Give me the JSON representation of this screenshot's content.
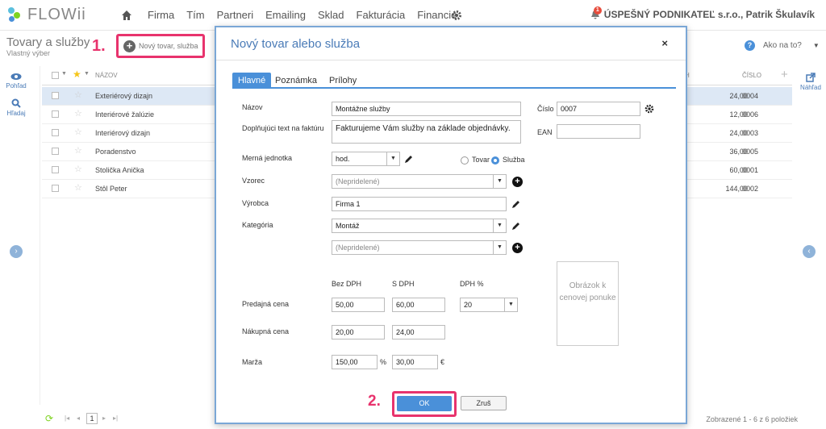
{
  "app": {
    "logo_text": "FLOWii"
  },
  "nav": {
    "items": [
      "Firma",
      "Tím",
      "Partneri",
      "Emailing",
      "Sklad",
      "Fakturácia",
      "Financie"
    ],
    "notifications_count": "1",
    "company": "ÚSPEŠNÝ PODNIKATEĽ s.r.o., Patrik Škulavík"
  },
  "page": {
    "title": "Tovary a služby",
    "subtitle": "Vlastný výber",
    "step1": "1.",
    "new_button": "Nový tovar, služba",
    "help": "Ako na to?"
  },
  "sidebar": {
    "view": "Pohľad",
    "search": "Hľadaj",
    "preview": "Náhľad"
  },
  "grid": {
    "col_name": "NÁZOV",
    "col_price_partial": "H",
    "col_number": "ČÍSLO",
    "rows": [
      {
        "name": "Exteriérový dizajn",
        "price": "24,00",
        "number": "0004"
      },
      {
        "name": "Interiérové žalúzie",
        "price": "12,00",
        "number": "0006"
      },
      {
        "name": "Interiérový dizajn",
        "price": "24,00",
        "number": "0003"
      },
      {
        "name": "Poradenstvo",
        "price": "36,00",
        "number": "0005"
      },
      {
        "name": "Stolička Anička",
        "price": "60,00",
        "number": "0001"
      },
      {
        "name": "Stôl Peter",
        "price": "144,00",
        "number": "0002"
      }
    ]
  },
  "footer": {
    "page": "1",
    "summary": "Zobrazené 1 - 6 z 6 položiek"
  },
  "modal": {
    "title": "Nový tovar alebo služba",
    "close": "×",
    "tabs": [
      "Hlavné",
      "Poznámka",
      "Prílohy"
    ],
    "labels": {
      "name": "Názov",
      "invoice_text": "Doplňujúci text na faktúru",
      "unit": "Merná jednotka",
      "pattern": "Vzorec",
      "manufacturer": "Výrobca",
      "category": "Kategória",
      "number": "Číslo",
      "ean": "EAN",
      "goods": "Tovar",
      "service": "Služba",
      "excl_vat": "Bez DPH",
      "incl_vat": "S DPH",
      "vat_pct": "DPH %",
      "sale_price": "Predajná cena",
      "purchase_price": "Nákupná cena",
      "margin": "Marža",
      "percent": "%",
      "euro": "€",
      "image": "Obrázok k cenovej ponuke"
    },
    "values": {
      "name": "Montážne služby",
      "invoice_text": "Fakturujeme Vám služby na základe objednávky.",
      "unit": "hod.",
      "pattern": "(Nepridelené)",
      "manufacturer": "Firma 1",
      "category": "Montáž",
      "subcategory": "(Nepridelené)",
      "number": "0007",
      "ean": "",
      "sale_excl": "50,00",
      "sale_incl": "60,00",
      "vat": "20",
      "purchase_excl": "20,00",
      "purchase_incl": "24,00",
      "margin_pct": "150,00",
      "margin_abs": "30,00"
    },
    "step2": "2.",
    "ok": "OK",
    "cancel": "Zruš"
  }
}
